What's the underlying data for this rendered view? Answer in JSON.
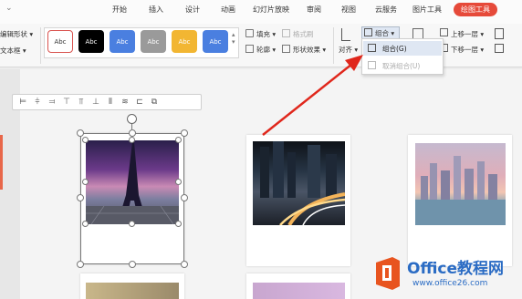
{
  "menu": {
    "tabs": [
      {
        "label": "开始",
        "active": false
      },
      {
        "label": "插入",
        "active": false
      },
      {
        "label": "设计",
        "active": false
      },
      {
        "label": "动画",
        "active": false
      },
      {
        "label": "幻灯片放映",
        "active": false
      },
      {
        "label": "审阅",
        "active": false
      },
      {
        "label": "视图",
        "active": false
      },
      {
        "label": "云服务",
        "active": false
      },
      {
        "label": "图片工具",
        "active": false
      },
      {
        "label": "绘图工具",
        "active": true
      }
    ]
  },
  "ribbon": {
    "edit_shape": "编辑形状 ▾",
    "text_box": "文本框 ▾",
    "shape_styles": [
      {
        "label": "Abc",
        "fill": "#ffffff",
        "text_color": "#333333",
        "border": "#d9534f"
      },
      {
        "label": "Abc",
        "fill": "#000000",
        "text_color": "#ffffff",
        "border": "#000000"
      },
      {
        "label": "Abc",
        "fill": "#4a7fe0",
        "text_color": "#ffffff",
        "border": "#4a7fe0"
      },
      {
        "label": "Abc",
        "fill": "#9a9a9a",
        "text_color": "#ffffff",
        "border": "#9a9a9a"
      },
      {
        "label": "Abc",
        "fill": "#f2b632",
        "text_color": "#ffffff",
        "border": "#f2b632"
      },
      {
        "label": "Abc",
        "fill": "#4a7fe0",
        "text_color": "#ffffff",
        "border": "#4a7fe0"
      }
    ],
    "fill": "填充 ▾",
    "outline": "轮廓 ▾",
    "format_painter": "格式刷",
    "shape_effects": "形状效果 ▾",
    "align": "对齐 ▾",
    "group": "组合 ▾",
    "bring_forward": "上移一层 ▾",
    "send_backward": "下移一层 ▾"
  },
  "dropdown": {
    "group_item": "组合(G)",
    "ungroup_item": "取消组合(U)"
  },
  "align_toolbar": {
    "icons": [
      "align-left-icon",
      "align-center-icon",
      "align-right-icon",
      "align-top-icon",
      "align-middle-icon",
      "align-bottom-icon",
      "distribute-horizontal-icon",
      "distribute-vertical-icon",
      "group-icon",
      "ungroup-icon"
    ]
  },
  "watermark": {
    "brand": "Office教程网",
    "url": "www.office26.com"
  },
  "colors": {
    "accent": "#e64a3a",
    "logo_orange": "#e8541f",
    "logo_blue": "#2b6cc4"
  }
}
